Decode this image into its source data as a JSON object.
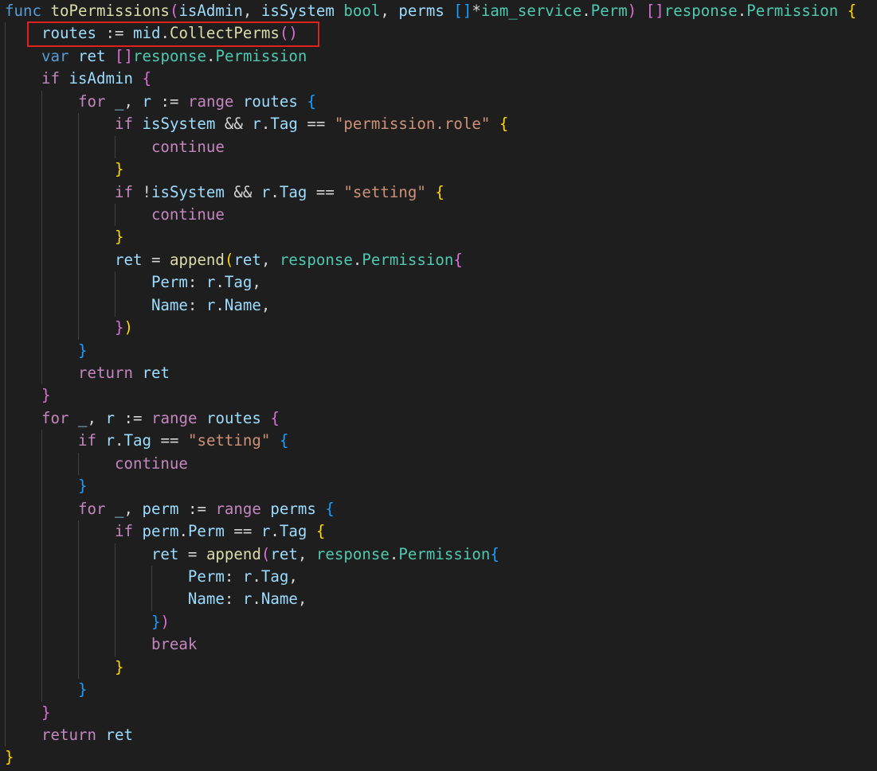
{
  "editor": {
    "language": "go",
    "highlight": {
      "label": "",
      "line_index": 1
    },
    "colors": {
      "background": "#1e1e1e",
      "default": "#d4d4d4",
      "keyword": "#569cd6",
      "control": "#c586c0",
      "function": "#dcdcaa",
      "variable": "#9cdcfe",
      "type": "#4ec9b0",
      "string": "#ce9178",
      "bracket1": "#ffd700",
      "bracket2": "#da70d6",
      "bracket3": "#179fff",
      "highlight_border": "#e0201a"
    },
    "lines": [
      {
        "indent": 0,
        "tokens": [
          [
            "func",
            "keyword"
          ],
          [
            " ",
            "default"
          ],
          [
            "toPermissions",
            "function"
          ],
          [
            "(",
            "bracket2"
          ],
          [
            "isAdmin",
            "variable"
          ],
          [
            ", ",
            "default"
          ],
          [
            "isSystem",
            "variable"
          ],
          [
            " ",
            "default"
          ],
          [
            "bool",
            "type"
          ],
          [
            ", ",
            "default"
          ],
          [
            "perms",
            "variable"
          ],
          [
            " ",
            "default"
          ],
          [
            "[]",
            "bracket3"
          ],
          [
            "*",
            "default"
          ],
          [
            "iam_service",
            "type"
          ],
          [
            ".",
            "default"
          ],
          [
            "Perm",
            "type"
          ],
          [
            ")",
            "bracket2"
          ],
          [
            " ",
            "default"
          ],
          [
            "[]",
            "bracket2"
          ],
          [
            "response",
            "type"
          ],
          [
            ".",
            "default"
          ],
          [
            "Permission",
            "type"
          ],
          [
            " ",
            "default"
          ],
          [
            "{",
            "bracket1"
          ]
        ]
      },
      {
        "indent": 1,
        "tokens": [
          [
            "routes",
            "variable"
          ],
          [
            " := ",
            "default"
          ],
          [
            "mid",
            "variable"
          ],
          [
            ".",
            "default"
          ],
          [
            "CollectPerms",
            "function"
          ],
          [
            "()",
            "bracket2"
          ]
        ]
      },
      {
        "indent": 1,
        "tokens": [
          [
            "var",
            "keyword"
          ],
          [
            " ",
            "default"
          ],
          [
            "ret",
            "variable"
          ],
          [
            " ",
            "default"
          ],
          [
            "[]",
            "bracket2"
          ],
          [
            "response",
            "type"
          ],
          [
            ".",
            "default"
          ],
          [
            "Permission",
            "type"
          ]
        ]
      },
      {
        "indent": 1,
        "tokens": [
          [
            "if",
            "control"
          ],
          [
            " ",
            "default"
          ],
          [
            "isAdmin",
            "variable"
          ],
          [
            " ",
            "default"
          ],
          [
            "{",
            "bracket2"
          ]
        ]
      },
      {
        "indent": 2,
        "tokens": [
          [
            "for",
            "control"
          ],
          [
            " ",
            "default"
          ],
          [
            "_",
            "variable"
          ],
          [
            ", ",
            "default"
          ],
          [
            "r",
            "variable"
          ],
          [
            " := ",
            "default"
          ],
          [
            "range",
            "control"
          ],
          [
            " ",
            "default"
          ],
          [
            "routes",
            "variable"
          ],
          [
            " ",
            "default"
          ],
          [
            "{",
            "bracket3"
          ]
        ]
      },
      {
        "indent": 3,
        "tokens": [
          [
            "if",
            "control"
          ],
          [
            " ",
            "default"
          ],
          [
            "isSystem",
            "variable"
          ],
          [
            " && ",
            "default"
          ],
          [
            "r",
            "variable"
          ],
          [
            ".",
            "default"
          ],
          [
            "Tag",
            "variable"
          ],
          [
            " == ",
            "default"
          ],
          [
            "\"permission.role\"",
            "string"
          ],
          [
            " ",
            "default"
          ],
          [
            "{",
            "bracket1"
          ]
        ]
      },
      {
        "indent": 4,
        "tokens": [
          [
            "continue",
            "control"
          ]
        ]
      },
      {
        "indent": 3,
        "tokens": [
          [
            "}",
            "bracket1"
          ]
        ]
      },
      {
        "indent": 3,
        "tokens": [
          [
            "if",
            "control"
          ],
          [
            " !",
            "default"
          ],
          [
            "isSystem",
            "variable"
          ],
          [
            " && ",
            "default"
          ],
          [
            "r",
            "variable"
          ],
          [
            ".",
            "default"
          ],
          [
            "Tag",
            "variable"
          ],
          [
            " == ",
            "default"
          ],
          [
            "\"setting\"",
            "string"
          ],
          [
            " ",
            "default"
          ],
          [
            "{",
            "bracket1"
          ]
        ]
      },
      {
        "indent": 4,
        "tokens": [
          [
            "continue",
            "control"
          ]
        ]
      },
      {
        "indent": 3,
        "tokens": [
          [
            "}",
            "bracket1"
          ]
        ]
      },
      {
        "indent": 3,
        "tokens": [
          [
            "ret",
            "variable"
          ],
          [
            " = ",
            "default"
          ],
          [
            "append",
            "function"
          ],
          [
            "(",
            "bracket1"
          ],
          [
            "ret",
            "variable"
          ],
          [
            ", ",
            "default"
          ],
          [
            "response",
            "type"
          ],
          [
            ".",
            "default"
          ],
          [
            "Permission",
            "type"
          ],
          [
            "{",
            "bracket2"
          ]
        ]
      },
      {
        "indent": 4,
        "tokens": [
          [
            "Perm",
            "variable"
          ],
          [
            ": ",
            "default"
          ],
          [
            "r",
            "variable"
          ],
          [
            ".",
            "default"
          ],
          [
            "Tag",
            "variable"
          ],
          [
            ",",
            "default"
          ]
        ]
      },
      {
        "indent": 4,
        "tokens": [
          [
            "Name",
            "variable"
          ],
          [
            ": ",
            "default"
          ],
          [
            "r",
            "variable"
          ],
          [
            ".",
            "default"
          ],
          [
            "Name",
            "variable"
          ],
          [
            ",",
            "default"
          ]
        ]
      },
      {
        "indent": 3,
        "tokens": [
          [
            "}",
            "bracket2"
          ],
          [
            ")",
            "bracket1"
          ]
        ]
      },
      {
        "indent": 2,
        "tokens": [
          [
            "}",
            "bracket3"
          ]
        ]
      },
      {
        "indent": 2,
        "tokens": [
          [
            "return",
            "control"
          ],
          [
            " ",
            "default"
          ],
          [
            "ret",
            "variable"
          ]
        ]
      },
      {
        "indent": 1,
        "tokens": [
          [
            "}",
            "bracket2"
          ]
        ]
      },
      {
        "indent": 1,
        "tokens": [
          [
            "for",
            "control"
          ],
          [
            " ",
            "default"
          ],
          [
            "_",
            "variable"
          ],
          [
            ", ",
            "default"
          ],
          [
            "r",
            "variable"
          ],
          [
            " := ",
            "default"
          ],
          [
            "range",
            "control"
          ],
          [
            " ",
            "default"
          ],
          [
            "routes",
            "variable"
          ],
          [
            " ",
            "default"
          ],
          [
            "{",
            "bracket2"
          ]
        ]
      },
      {
        "indent": 2,
        "tokens": [
          [
            "if",
            "control"
          ],
          [
            " ",
            "default"
          ],
          [
            "r",
            "variable"
          ],
          [
            ".",
            "default"
          ],
          [
            "Tag",
            "variable"
          ],
          [
            " == ",
            "default"
          ],
          [
            "\"setting\"",
            "string"
          ],
          [
            " ",
            "default"
          ],
          [
            "{",
            "bracket3"
          ]
        ]
      },
      {
        "indent": 3,
        "tokens": [
          [
            "continue",
            "control"
          ]
        ]
      },
      {
        "indent": 2,
        "tokens": [
          [
            "}",
            "bracket3"
          ]
        ]
      },
      {
        "indent": 2,
        "tokens": [
          [
            "for",
            "control"
          ],
          [
            " ",
            "default"
          ],
          [
            "_",
            "variable"
          ],
          [
            ", ",
            "default"
          ],
          [
            "perm",
            "variable"
          ],
          [
            " := ",
            "default"
          ],
          [
            "range",
            "control"
          ],
          [
            " ",
            "default"
          ],
          [
            "perms",
            "variable"
          ],
          [
            " ",
            "default"
          ],
          [
            "{",
            "bracket3"
          ]
        ]
      },
      {
        "indent": 3,
        "tokens": [
          [
            "if",
            "control"
          ],
          [
            " ",
            "default"
          ],
          [
            "perm",
            "variable"
          ],
          [
            ".",
            "default"
          ],
          [
            "Perm",
            "variable"
          ],
          [
            " == ",
            "default"
          ],
          [
            "r",
            "variable"
          ],
          [
            ".",
            "default"
          ],
          [
            "Tag",
            "variable"
          ],
          [
            " ",
            "default"
          ],
          [
            "{",
            "bracket1"
          ]
        ]
      },
      {
        "indent": 4,
        "tokens": [
          [
            "ret",
            "variable"
          ],
          [
            " = ",
            "default"
          ],
          [
            "append",
            "function"
          ],
          [
            "(",
            "bracket2"
          ],
          [
            "ret",
            "variable"
          ],
          [
            ", ",
            "default"
          ],
          [
            "response",
            "type"
          ],
          [
            ".",
            "default"
          ],
          [
            "Permission",
            "type"
          ],
          [
            "{",
            "bracket3"
          ]
        ]
      },
      {
        "indent": 5,
        "tokens": [
          [
            "Perm",
            "variable"
          ],
          [
            ": ",
            "default"
          ],
          [
            "r",
            "variable"
          ],
          [
            ".",
            "default"
          ],
          [
            "Tag",
            "variable"
          ],
          [
            ",",
            "default"
          ]
        ]
      },
      {
        "indent": 5,
        "tokens": [
          [
            "Name",
            "variable"
          ],
          [
            ": ",
            "default"
          ],
          [
            "r",
            "variable"
          ],
          [
            ".",
            "default"
          ],
          [
            "Name",
            "variable"
          ],
          [
            ",",
            "default"
          ]
        ]
      },
      {
        "indent": 4,
        "tokens": [
          [
            "}",
            "bracket3"
          ],
          [
            ")",
            "bracket2"
          ]
        ]
      },
      {
        "indent": 4,
        "tokens": [
          [
            "break",
            "control"
          ]
        ]
      },
      {
        "indent": 3,
        "tokens": [
          [
            "}",
            "bracket1"
          ]
        ]
      },
      {
        "indent": 2,
        "tokens": [
          [
            "}",
            "bracket3"
          ]
        ]
      },
      {
        "indent": 1,
        "tokens": [
          [
            "}",
            "bracket2"
          ]
        ]
      },
      {
        "indent": 1,
        "tokens": [
          [
            "return",
            "control"
          ],
          [
            " ",
            "default"
          ],
          [
            "ret",
            "variable"
          ]
        ]
      },
      {
        "indent": 0,
        "tokens": [
          [
            "}",
            "bracket1"
          ]
        ]
      }
    ]
  }
}
